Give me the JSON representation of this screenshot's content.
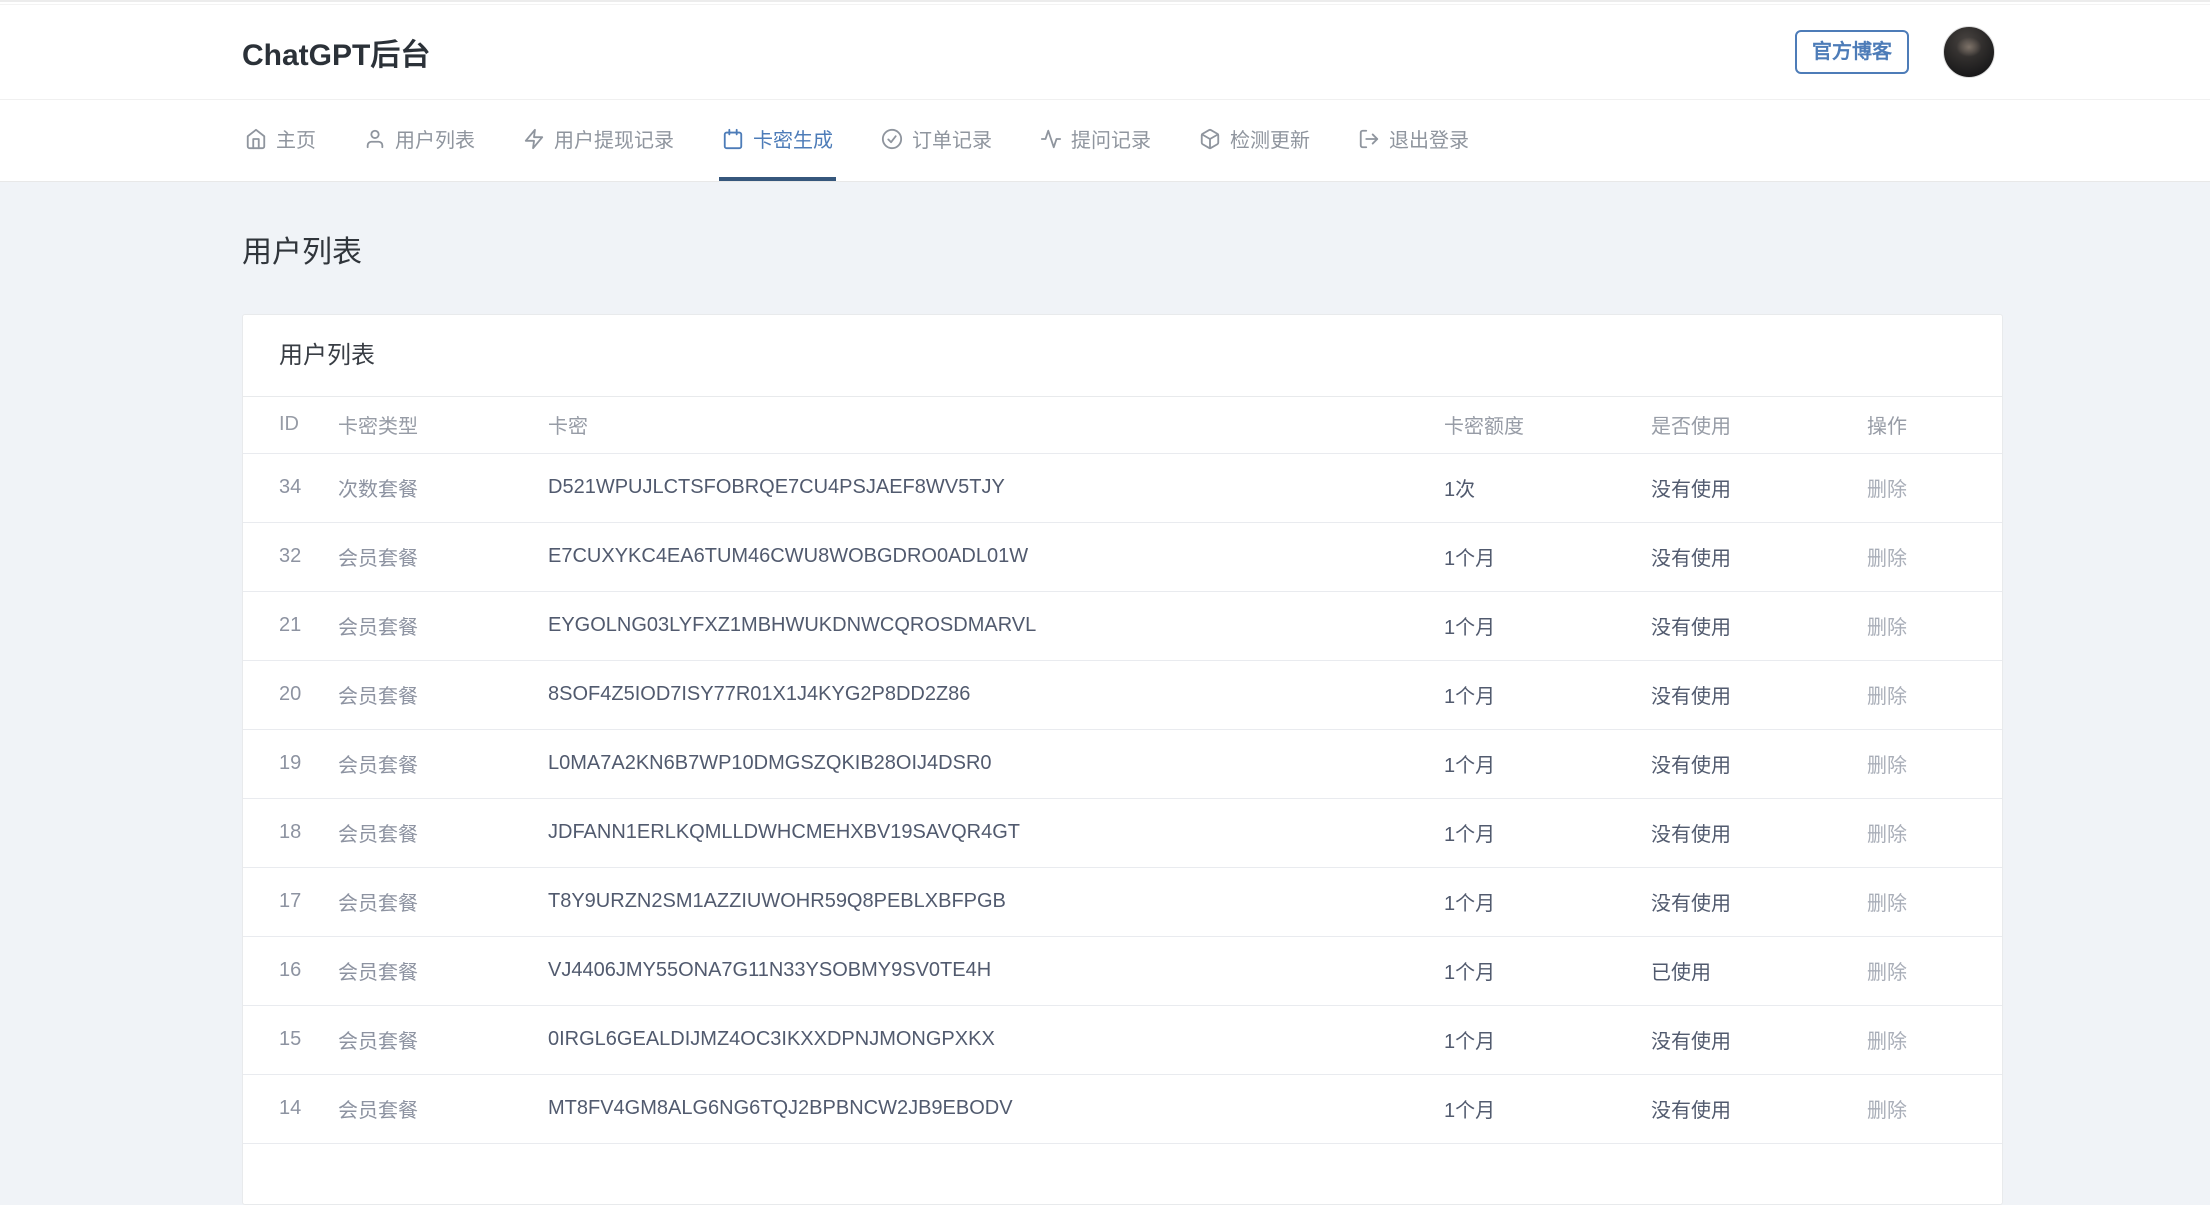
{
  "header": {
    "title": "ChatGPT后台",
    "blog_button": "官方博客"
  },
  "nav": {
    "items": [
      {
        "label": "主页",
        "icon": "home-icon",
        "active": false
      },
      {
        "label": "用户列表",
        "icon": "user-icon",
        "active": false
      },
      {
        "label": "用户提现记录",
        "icon": "zap-icon",
        "active": false
      },
      {
        "label": "卡密生成",
        "icon": "calendar-icon",
        "active": true
      },
      {
        "label": "订单记录",
        "icon": "check-circle-icon",
        "active": false
      },
      {
        "label": "提问记录",
        "icon": "activity-icon",
        "active": false
      },
      {
        "label": "检测更新",
        "icon": "box-icon",
        "active": false
      },
      {
        "label": "退出登录",
        "icon": "logout-icon",
        "active": false
      }
    ]
  },
  "page": {
    "title": "用户列表"
  },
  "card": {
    "title": "用户列表"
  },
  "table": {
    "columns": [
      "ID",
      "卡密类型",
      "卡密",
      "卡密额度",
      "是否使用",
      "操作"
    ],
    "action_label": "删除",
    "rows": [
      {
        "id": "34",
        "type": "次数套餐",
        "key": "D521WPUJLCTSFOBRQE7CU4PSJAEF8WV5TJY",
        "quota": "1次",
        "used": "没有使用"
      },
      {
        "id": "32",
        "type": "会员套餐",
        "key": "E7CUXYKC4EA6TUM46CWU8WOBGDRO0ADL01W",
        "quota": "1个月",
        "used": "没有使用"
      },
      {
        "id": "21",
        "type": "会员套餐",
        "key": "EYGOLNG03LYFXZ1MBHWUKDNWCQROSDMARVL",
        "quota": "1个月",
        "used": "没有使用"
      },
      {
        "id": "20",
        "type": "会员套餐",
        "key": "8SOF4Z5IOD7ISY77R01X1J4KYG2P8DD2Z86",
        "quota": "1个月",
        "used": "没有使用"
      },
      {
        "id": "19",
        "type": "会员套餐",
        "key": "L0MA7A2KN6B7WP10DMGSZQKIB28OIJ4DSR0",
        "quota": "1个月",
        "used": "没有使用"
      },
      {
        "id": "18",
        "type": "会员套餐",
        "key": "JDFANN1ERLKQMLLDWHCMEHXBV19SAVQR4GT",
        "quota": "1个月",
        "used": "没有使用"
      },
      {
        "id": "17",
        "type": "会员套餐",
        "key": "T8Y9URZN2SM1AZZIUWOHR59Q8PEBLXBFPGB",
        "quota": "1个月",
        "used": "没有使用"
      },
      {
        "id": "16",
        "type": "会员套餐",
        "key": "VJ4406JMY55ONA7G11N33YSOBMY9SV0TE4H",
        "quota": "1个月",
        "used": "已使用"
      },
      {
        "id": "15",
        "type": "会员套餐",
        "key": "0IRGL6GEALDIJMZ4OC3IKXXDPNJMONGPXKX",
        "quota": "1个月",
        "used": "没有使用"
      },
      {
        "id": "14",
        "type": "会员套餐",
        "key": "MT8FV4GM8ALG6NG6TQJ2BPBNCW2JB9EBODV",
        "quota": "1个月",
        "used": "没有使用"
      }
    ]
  },
  "colors": {
    "accent": "#4d7cb8",
    "active_underline": "#36577c",
    "page_background": "#f0f3f7"
  }
}
